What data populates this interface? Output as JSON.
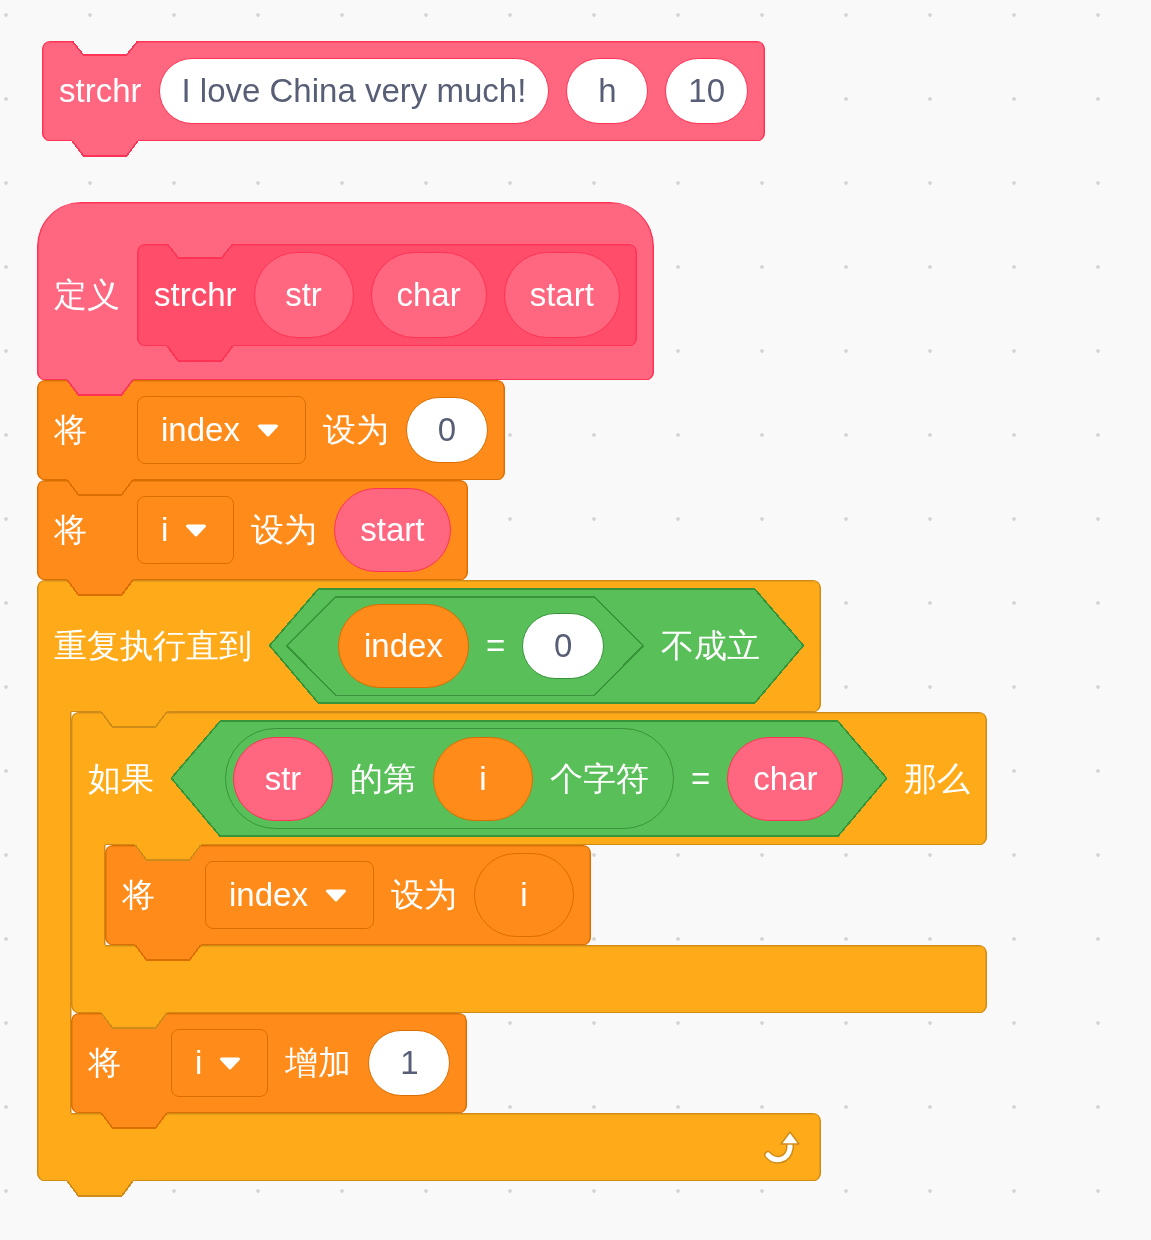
{
  "call_block": {
    "name": "strchr",
    "inputs": [
      "I love China very much!",
      "h",
      "10"
    ]
  },
  "define_block": {
    "label": "定义",
    "prototype": {
      "name": "strchr",
      "params": [
        "str",
        "char",
        "start"
      ]
    }
  },
  "script": [
    {
      "kind": "set",
      "parts": [
        {
          "kind": "label",
          "text": "将"
        },
        {
          "kind": "dropdown",
          "text": "index"
        },
        {
          "kind": "label",
          "text": "设为"
        },
        {
          "kind": "input",
          "text": "0"
        }
      ]
    },
    {
      "kind": "set",
      "parts": [
        {
          "kind": "label",
          "text": "将"
        },
        {
          "kind": "dropdown",
          "text": "i"
        },
        {
          "kind": "label",
          "text": "设为"
        },
        {
          "kind": "param",
          "text": "start"
        }
      ]
    },
    {
      "kind": "repeat_until",
      "parts": [
        {
          "kind": "label",
          "text": "重复执行直到"
        },
        {
          "kind": "boolean",
          "parts": [
            {
              "kind": "boolean",
              "parts": [
                {
                  "kind": "variable",
                  "text": "index"
                },
                {
                  "kind": "label",
                  "text": "="
                },
                {
                  "kind": "input",
                  "text": "0"
                }
              ]
            },
            {
              "kind": "label",
              "text": "不成立"
            }
          ]
        }
      ],
      "children": [
        {
          "kind": "if",
          "parts": [
            {
              "kind": "label",
              "text": "如果"
            },
            {
              "kind": "boolean",
              "parts": [
                {
                  "kind": "reporter",
                  "parts": [
                    {
                      "kind": "param",
                      "text": "str"
                    },
                    {
                      "kind": "label",
                      "text": "的第"
                    },
                    {
                      "kind": "variable",
                      "text": "i"
                    },
                    {
                      "kind": "label",
                      "text": "个字符"
                    }
                  ]
                },
                {
                  "kind": "label",
                  "text": "="
                },
                {
                  "kind": "param",
                  "text": "char"
                }
              ]
            },
            {
              "kind": "label",
              "text": "那么"
            }
          ],
          "children": [
            {
              "kind": "set",
              "parts": [
                {
                  "kind": "label",
                  "text": "将"
                },
                {
                  "kind": "dropdown",
                  "text": "index"
                },
                {
                  "kind": "label",
                  "text": "设为"
                },
                {
                  "kind": "variable",
                  "text": "i"
                }
              ]
            }
          ]
        },
        {
          "kind": "change",
          "parts": [
            {
              "kind": "label",
              "text": "将"
            },
            {
              "kind": "dropdown",
              "text": "i"
            },
            {
              "kind": "label",
              "text": "增加"
            },
            {
              "kind": "input",
              "text": "1"
            }
          ]
        }
      ]
    }
  ]
}
